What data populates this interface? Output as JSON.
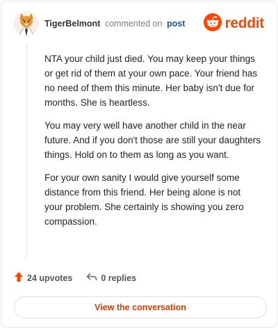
{
  "header": {
    "username": "TigerBelmont",
    "action_text": "commented on",
    "post_link": "post",
    "brand": "reddit"
  },
  "comment": {
    "paragraphs": [
      "NTA your child just died. You may keep your things or get rid of them at your own pace. Your friend has no need of them this minute. Her baby isn't due for months. She is heartless.",
      "You may very well have another child in the near future. And if you don't those are still your daughters things. Hold on to them as long as you want.",
      "For your own sanity I would give yourself some distance from this friend. Her being alone is not your problem. She certainly is showing you zero compassion."
    ]
  },
  "actions": {
    "upvotes": "24 upvotes",
    "replies": "0 replies"
  },
  "cta": {
    "label": "View the conversation"
  },
  "colors": {
    "brand": "#ff4500",
    "link": "#1a4fa0",
    "cta": "#d93a00"
  },
  "icons": [
    "avatar",
    "reddit-logo-icon",
    "upvote-arrow-icon",
    "reply-arrow-icon"
  ]
}
